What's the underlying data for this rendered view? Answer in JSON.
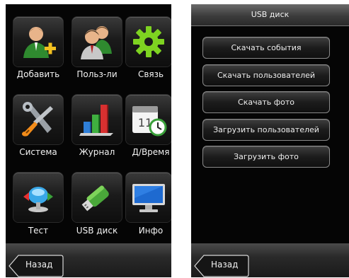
{
  "left_screen": {
    "tiles": [
      {
        "label": "Добавить",
        "icon": "add-user-icon"
      },
      {
        "label": "Польз-ли",
        "icon": "users-icon"
      },
      {
        "label": "Связь",
        "icon": "gear-icon"
      },
      {
        "label": "Система",
        "icon": "tools-icon"
      },
      {
        "label": "Журнал",
        "icon": "bar-chart-icon"
      },
      {
        "label": "Д/Время",
        "icon": "calendar-clock-icon"
      },
      {
        "label": "Тест",
        "icon": "test-icon"
      },
      {
        "label": "USB диск",
        "icon": "usb-drive-icon"
      },
      {
        "label": "Инфо",
        "icon": "monitor-icon"
      }
    ],
    "back_label": "Назад"
  },
  "right_screen": {
    "title": "USB диск",
    "buttons": [
      "Скачать события",
      "Скачать пользователей",
      "Скачать фото",
      "Загрузить пользователей",
      "Загрузить фото"
    ],
    "back_label": "Назад"
  },
  "colors": {
    "screen_bg": "#050505",
    "bar": "#2a2a2a",
    "text": "#f2f2f2"
  }
}
